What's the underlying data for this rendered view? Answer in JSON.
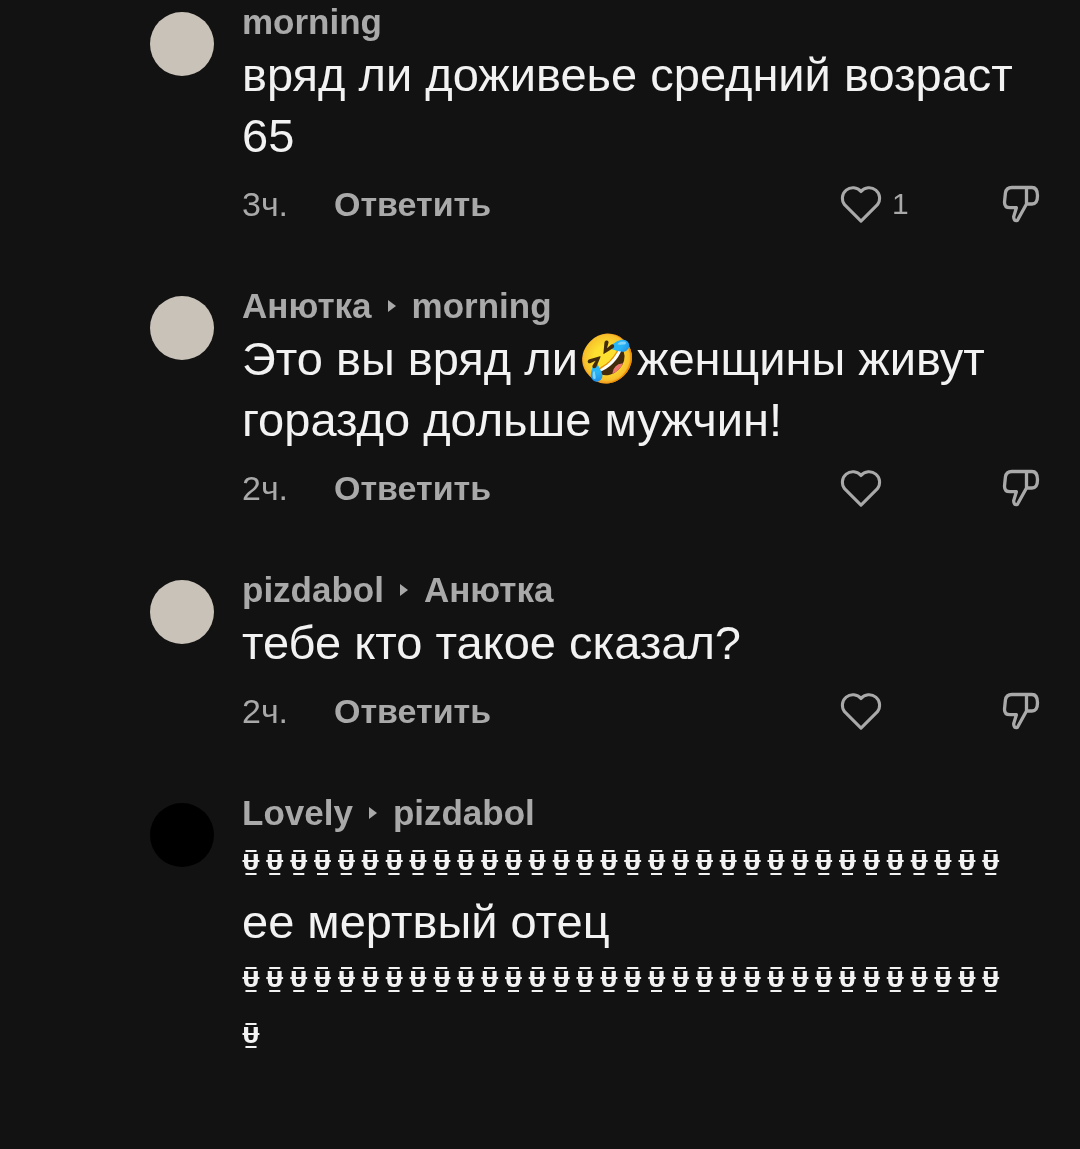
{
  "comments": [
    {
      "author": "morning",
      "has_photo": true,
      "lines": [
        "вряд ли доживеье средний возраст 65"
      ],
      "time": "3ч.",
      "reply": "Ответить",
      "likes": "1"
    },
    {
      "author": "Анютка",
      "reply_to": "morning",
      "has_photo": true,
      "lines": [
        "Это вы вряд ли🤣женщины живут гораздо дольше мужчин!"
      ],
      "time": "2ч.",
      "reply": "Ответить"
    },
    {
      "author": "pizdabol",
      "reply_to": "Анютка",
      "has_photo": true,
      "lines": [
        "тебе кто такое сказал?"
      ],
      "time": "2ч.",
      "reply": "Ответить"
    },
    {
      "author": "Lovely",
      "reply_to": "pizdabol",
      "has_photo": false,
      "lines": [
        "Ʉ̲̅Ʉ̲̅Ʉ̲̅Ʉ̲̅Ʉ̲̅Ʉ̲̅Ʉ̲̅Ʉ̲̅Ʉ̲̅Ʉ̲̅Ʉ̲̅Ʉ̲̅Ʉ̲̅Ʉ̲̅Ʉ̲̅Ʉ̲̅Ʉ̲̅Ʉ̲̅Ʉ̲̅Ʉ̲̅Ʉ̲̅Ʉ̲̅Ʉ̲̅Ʉ̲̅Ʉ̲̅Ʉ̲̅Ʉ̲̅Ʉ̲̅Ʉ̲̅Ʉ̲̅Ʉ̲̅Ʉ̲̅",
        "ее мертвый отец",
        "Ʉ̲̅Ʉ̲̅Ʉ̲̅Ʉ̲̅Ʉ̲̅Ʉ̲̅Ʉ̲̅Ʉ̲̅Ʉ̲̅Ʉ̲̅Ʉ̲̅Ʉ̲̅Ʉ̲̅Ʉ̲̅Ʉ̲̅Ʉ̲̅Ʉ̲̅Ʉ̲̅Ʉ̲̅Ʉ̲̅Ʉ̲̅Ʉ̲̅Ʉ̲̅Ʉ̲̅Ʉ̲̅Ʉ̲̅Ʉ̲̅Ʉ̲̅Ʉ̲̅Ʉ̲̅Ʉ̲̅Ʉ̲̅",
        "Ʉ̲̅"
      ]
    }
  ]
}
